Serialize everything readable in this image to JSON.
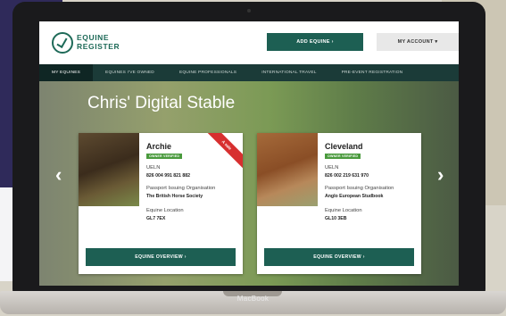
{
  "header": {
    "logo_line1": "EQUINE",
    "logo_line2": "REGISTER",
    "add_equine": "ADD EQUINE ›",
    "my_account": "MY ACCOUNT ▾"
  },
  "nav": {
    "items": [
      {
        "label": "MY EQUINES",
        "active": true
      },
      {
        "label": "EQUINES I'VE OWNED",
        "active": false
      },
      {
        "label": "EQUINE PROFESSIONALS",
        "active": false
      },
      {
        "label": "INTERNATIONAL TRAVEL",
        "active": false
      },
      {
        "label": "PRE-EVENT REGISTRATION",
        "active": false
      }
    ]
  },
  "hero": {
    "title": "Chris' Digital Stable"
  },
  "cards": [
    {
      "name": "Archie",
      "badge": "OWNER VERIFIED",
      "ribbon": "A sale",
      "ueln_label": "UELN",
      "ueln": "826 004 991 821 882",
      "org_label": "Passport Issuing Organisation",
      "org": "The British Horse Society",
      "loc_label": "Equine Location",
      "loc": "GL7 7EX",
      "button": "EQUINE OVERVIEW ›"
    },
    {
      "name": "Cleveland",
      "badge": "OWNER VERIFIED",
      "ueln_label": "UELN",
      "ueln": "826 002 219 631 970",
      "org_label": "Passport Issuing Organisation",
      "org": "Anglo European Studbook",
      "loc_label": "Equine Location",
      "loc": "GL10 3EB",
      "button": "EQUINE OVERVIEW ›"
    }
  ],
  "arrows": {
    "prev": "‹",
    "next": "›"
  },
  "device": {
    "label": "MacBook"
  },
  "colors": {
    "brand_green": "#1d5f53",
    "nav_dark": "#1b3b38",
    "verified_green": "#4a9a3d",
    "ribbon_red": "#d72f2f"
  }
}
